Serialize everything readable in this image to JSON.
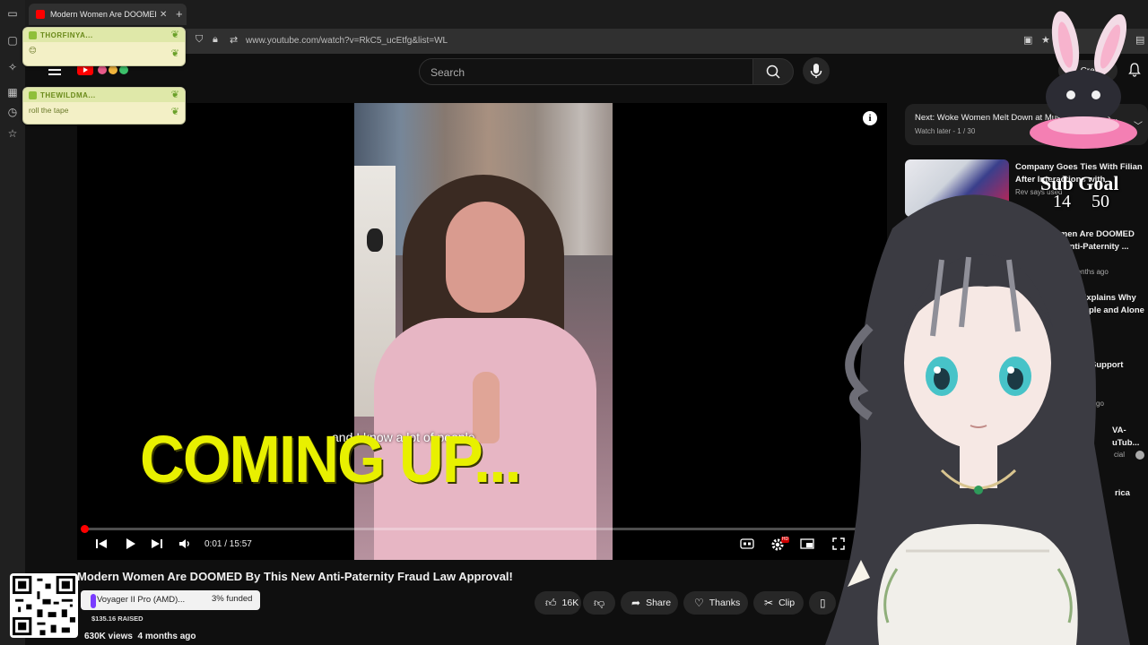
{
  "browser": {
    "tab_title": "Modern Women Are DOOMED",
    "tab_close": "✕",
    "new_tab": "+",
    "url": "www.youtube.com/watch?v=RkC5_ucEtfg&list=WL"
  },
  "header": {
    "search_placeholder": "Search",
    "create_label": "Create",
    "create_plus": "+"
  },
  "player": {
    "caption": "and I know a lot of people",
    "overlay_text": "COMING UP...",
    "info": "i",
    "time": "0:01 / 15:57",
    "progress_fraction": 0.001,
    "hd": "HD"
  },
  "video": {
    "title": "Modern Women Are DOOMED By This New Anti-Paternity Fraud Law Approval!",
    "likes": "16K",
    "share_label": "Share",
    "thanks_label": "Thanks",
    "clip_label": "Clip",
    "views": "630K views",
    "age": "4 months ago"
  },
  "sidebar": {
    "next_title": "Next: Woke Women Melt Down at Must-See Sexy S...",
    "next_sub": "Watch later - 1 / 30",
    "items": [
      {
        "title1": "Company Goes Ties With Filian",
        "title2": "After Interactions with",
        "meta": "Rev says used"
      },
      {
        "title1": "omen Are DOOMED",
        "title2": "w Anti-Paternity ...",
        "meta": "months ago"
      },
      {
        "title1": "Explains Why",
        "title2": "ple and Alone",
        "meta": "go"
      },
      {
        "title1": "Support",
        "title2": "",
        "meta": "go"
      },
      {
        "title1": "VA-",
        "title2": "uTub...",
        "meta": "cial"
      },
      {
        "title1": "rica",
        "title2": "",
        "meta": ""
      }
    ]
  },
  "chat": [
    {
      "user": "THORFINYA...",
      "message": "😊"
    },
    {
      "user": "THEWILDMA...",
      "message": "roll the tape"
    }
  ],
  "overlay": {
    "sub_goal_label": "Sub Goal",
    "sub_goal_count": "14 50"
  },
  "donation": {
    "item": "Voyager II Pro (AMD)...",
    "funded": "3% funded",
    "raised": "$135.16 RAISED",
    "funded_fraction": 0.03
  },
  "colors": {
    "youtube_red": "#ff0000",
    "overlay_yellow": "#e8f000",
    "chat_green": "#6a8a1a"
  }
}
